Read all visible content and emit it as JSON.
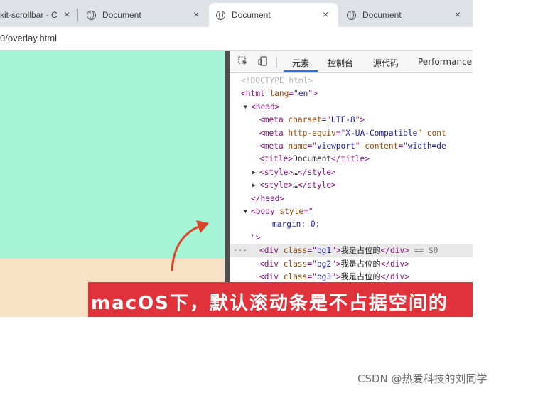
{
  "browser": {
    "tabs": [
      {
        "title": "kit-scrollbar - C",
        "active": false
      },
      {
        "title": "Document",
        "active": false
      },
      {
        "title": "Document",
        "active": true
      },
      {
        "title": "Document",
        "active": false
      }
    ],
    "url": "0/overlay.html",
    "close_glyph": "×"
  },
  "page": {
    "colors": {
      "top": "#a5f4d5",
      "bottom": "#f8e2c6",
      "scrollbar": "#4e4f51"
    }
  },
  "devtools": {
    "tabs": [
      "元素",
      "控制台",
      "源代码",
      "Performance"
    ],
    "selected_tab": "元素",
    "dom_lines": [
      {
        "parts": [
          {
            "t": "<!DOCTYPE html>",
            "c": "cm"
          }
        ]
      },
      {
        "parts": [
          {
            "t": "<html ",
            "c": "tag"
          },
          {
            "t": "lang",
            "c": "attr"
          },
          {
            "t": "=\"",
            "c": "tag"
          },
          {
            "t": "en",
            "c": "val"
          },
          {
            "t": "\">",
            "c": "tag"
          }
        ]
      },
      {
        "tri": "▼",
        "parts": [
          {
            "t": "<head>",
            "c": "tag"
          }
        ]
      },
      {
        "parts": [
          {
            "t": "<meta ",
            "c": "tag"
          },
          {
            "t": "charset",
            "c": "attr"
          },
          {
            "t": "=\"",
            "c": "tag"
          },
          {
            "t": "UTF-8",
            "c": "val"
          },
          {
            "t": "\">",
            "c": "tag"
          }
        ]
      },
      {
        "parts": [
          {
            "t": "<meta ",
            "c": "tag"
          },
          {
            "t": "http-equiv",
            "c": "attr"
          },
          {
            "t": "=\"",
            "c": "tag"
          },
          {
            "t": "X-UA-Compatible",
            "c": "val"
          },
          {
            "t": "\" cont",
            "c": "attr"
          }
        ]
      },
      {
        "parts": [
          {
            "t": "<meta ",
            "c": "tag"
          },
          {
            "t": "name",
            "c": "attr"
          },
          {
            "t": "=\"",
            "c": "tag"
          },
          {
            "t": "viewport",
            "c": "val"
          },
          {
            "t": "\" ",
            "c": "tag"
          },
          {
            "t": "content",
            "c": "attr"
          },
          {
            "t": "=\"",
            "c": "tag"
          },
          {
            "t": "width=de",
            "c": "val"
          }
        ]
      },
      {
        "parts": [
          {
            "t": "<title>",
            "c": "tag"
          },
          {
            "t": "Document",
            "c": "txt"
          },
          {
            "t": "</title>",
            "c": "tag"
          }
        ]
      },
      {
        "tri": "▶",
        "parts": [
          {
            "t": "<style>",
            "c": "tag"
          },
          {
            "t": "…",
            "c": "txt"
          },
          {
            "t": "</style>",
            "c": "tag"
          }
        ]
      },
      {
        "tri": "▶",
        "parts": [
          {
            "t": "<style>",
            "c": "tag"
          },
          {
            "t": "…",
            "c": "txt"
          },
          {
            "t": "</style>",
            "c": "tag"
          }
        ]
      },
      {
        "parts": [
          {
            "t": "</head>",
            "c": "tag"
          }
        ]
      },
      {
        "tri": "▼",
        "parts": [
          {
            "t": "<body ",
            "c": "tag"
          },
          {
            "t": "style",
            "c": "attr"
          },
          {
            "t": "=\"",
            "c": "tag"
          }
        ]
      },
      {
        "parts": [
          {
            "t": "margin: 0;",
            "c": "val"
          }
        ]
      },
      {
        "parts": [
          {
            "t": "\">",
            "c": "tag"
          }
        ]
      },
      {
        "hl": true,
        "dots": "···",
        "parts": [
          {
            "t": "<div ",
            "c": "tag"
          },
          {
            "t": "class",
            "c": "attr"
          },
          {
            "t": "=\"",
            "c": "tag"
          },
          {
            "t": "bg1",
            "c": "val"
          },
          {
            "t": "\">",
            "c": "tag"
          },
          {
            "t": "我是占位的",
            "c": "txt"
          },
          {
            "t": "</div>",
            "c": "tag"
          },
          {
            "t": " == $0",
            "c": "eqs"
          }
        ]
      },
      {
        "parts": [
          {
            "t": "<div ",
            "c": "tag"
          },
          {
            "t": "class",
            "c": "attr"
          },
          {
            "t": "=\"",
            "c": "tag"
          },
          {
            "t": "bg2",
            "c": "val"
          },
          {
            "t": "\">",
            "c": "tag"
          },
          {
            "t": "我是占位的",
            "c": "txt"
          },
          {
            "t": "</div>",
            "c": "tag"
          }
        ]
      },
      {
        "parts": [
          {
            "t": "<div ",
            "c": "tag"
          },
          {
            "t": "class",
            "c": "attr"
          },
          {
            "t": "=\"",
            "c": "tag"
          },
          {
            "t": "bg3",
            "c": "val"
          },
          {
            "t": "\">",
            "c": "tag"
          },
          {
            "t": "我是占位的",
            "c": "txt"
          },
          {
            "t": "</div>",
            "c": "tag"
          }
        ]
      }
    ]
  },
  "annotation": {
    "text": "macOS下，默认滚动条是不占据空间的",
    "banner_color": "#e0323a",
    "arrow_color": "#d9472b"
  },
  "watermark": "CSDN @热爱科技的刘同学"
}
